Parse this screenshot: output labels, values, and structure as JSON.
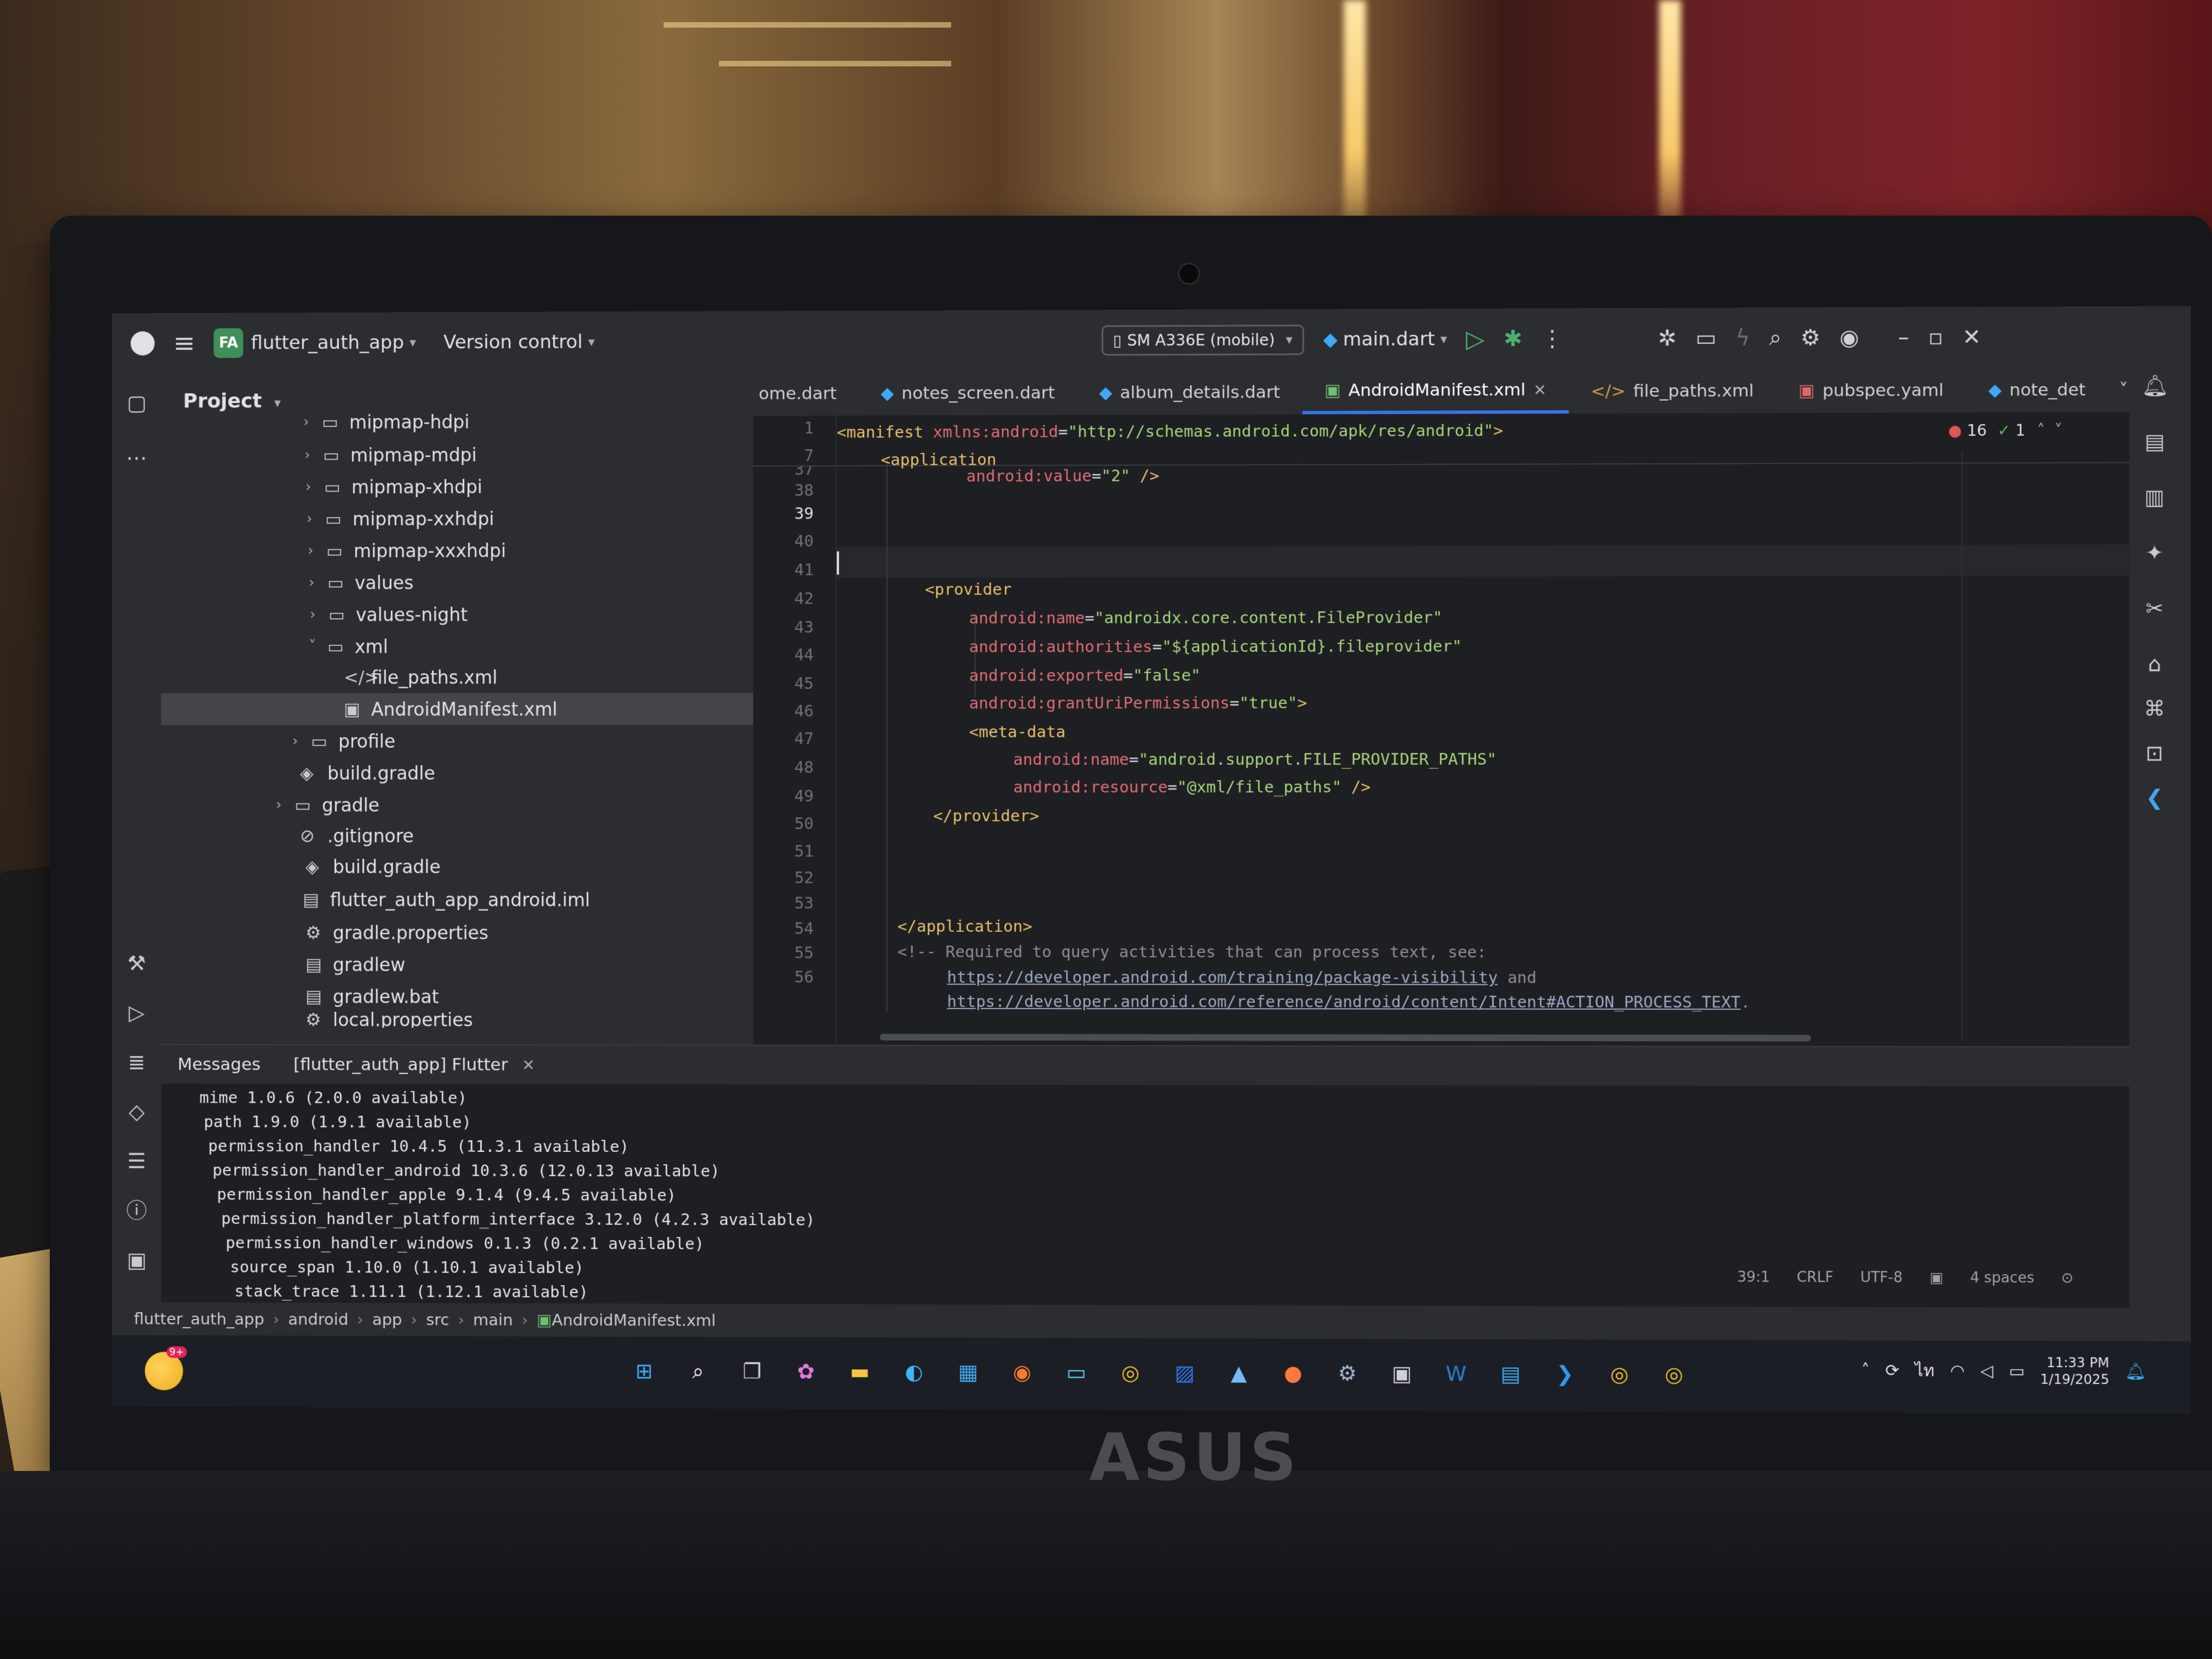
{
  "ide": {
    "project_badge": "FA",
    "project_name": "flutter_auth_app",
    "version_control": "Version control",
    "device": "SM A336E (mobile)",
    "run_config": "main.dart"
  },
  "project_panel": {
    "title": "Project",
    "tree": [
      {
        "label": "mipmap-hdpi",
        "type": "folder"
      },
      {
        "label": "mipmap-mdpi",
        "type": "folder"
      },
      {
        "label": "mipmap-xhdpi",
        "type": "folder"
      },
      {
        "label": "mipmap-xxhdpi",
        "type": "folder"
      },
      {
        "label": "mipmap-xxxhdpi",
        "type": "folder"
      },
      {
        "label": "values",
        "type": "folder"
      },
      {
        "label": "values-night",
        "type": "folder"
      },
      {
        "label": "xml",
        "type": "folder-open"
      },
      {
        "label": "file_paths.xml",
        "type": "xml"
      },
      {
        "label": "AndroidManifest.xml",
        "type": "manifest"
      },
      {
        "label": "profile",
        "type": "folder"
      },
      {
        "label": "build.gradle",
        "type": "gradle"
      },
      {
        "label": "gradle",
        "type": "folder"
      },
      {
        "label": ".gitignore",
        "type": "ignore"
      },
      {
        "label": "build.gradle",
        "type": "gradle"
      },
      {
        "label": "flutter_auth_app_android.iml",
        "type": "file"
      },
      {
        "label": "gradle.properties",
        "type": "settings"
      },
      {
        "label": "gradlew",
        "type": "file"
      },
      {
        "label": "gradlew.bat",
        "type": "file"
      },
      {
        "label": "local.properties",
        "type": "settings"
      }
    ]
  },
  "tabs": [
    {
      "label": "ome.dart",
      "icon": "none"
    },
    {
      "label": "notes_screen.dart",
      "icon": "dart"
    },
    {
      "label": "album_details.dart",
      "icon": "dart"
    },
    {
      "label": "AndroidManifest.xml",
      "icon": "manifest",
      "active": true
    },
    {
      "label": "file_paths.xml",
      "icon": "xml"
    },
    {
      "label": "pubspec.yaml",
      "icon": "yaml"
    },
    {
      "label": "note_det",
      "icon": "dart"
    }
  ],
  "inspections": {
    "errors": "16",
    "ok": "1"
  },
  "editor": {
    "line_numbers": [
      "1",
      "7",
      "37",
      "38",
      "39",
      "40",
      "41",
      "42",
      "43",
      "44",
      "45",
      "46",
      "47",
      "48",
      "49",
      "50",
      "51",
      "52",
      "53",
      "54",
      "55",
      "56"
    ],
    "current_line": "39",
    "sticky_1": {
      "tag": "<manifest ",
      "attr": "xmlns:android",
      "eq": "=",
      "val": "\"http://schemas.android.com/apk/res/android\"",
      "end": ">"
    },
    "sticky_2": {
      "tag": "<application"
    },
    "line_37": {
      "attr": "android:value",
      "eq": "=",
      "val": "\"2\"",
      "end": " />"
    },
    "line_40": {
      "tag": "<provider"
    },
    "line_41": {
      "attr": "android:name",
      "eq": "=",
      "val": "\"androidx.core.content.FileProvider\""
    },
    "line_42": {
      "attr": "android:authorities",
      "eq": "=",
      "val": "\"${applicationId}.fileprovider\""
    },
    "line_43": {
      "attr": "android:exported",
      "eq": "=",
      "val": "\"false\""
    },
    "line_44": {
      "attr": "android:grantUriPermissions",
      "eq": "=",
      "val": "\"true\"",
      "end": ">"
    },
    "line_45": {
      "tag": "<meta-data"
    },
    "line_46": {
      "attr": "android:name",
      "eq": "=",
      "val": "\"android.support.FILE_PROVIDER_PATHS\""
    },
    "line_47": {
      "attr": "android:resource",
      "eq": "=",
      "val": "\"@xml/file_paths\"",
      "end": " />"
    },
    "line_48": {
      "tag": "</provider>"
    },
    "line_52": {
      "tag": "</application>"
    },
    "line_53": {
      "comment": "<!-- Required to query activities that can process text, see:"
    },
    "line_54": {
      "link": "https://developer.android.com/training/package-visibility",
      "after": " and"
    },
    "line_55": {
      "link": "https://developer.android.com/reference/android/content/Intent#ACTION_PROCESS_TEXT",
      "after": "."
    }
  },
  "messages": {
    "tab_1": "Messages",
    "tab_2": "[flutter_auth_app] Flutter",
    "lines": [
      "mime 1.0.6 (2.0.0 available)",
      "path 1.9.0 (1.9.1 available)",
      "permission_handler 10.4.5 (11.3.1 available)",
      "permission_handler_android 10.3.6 (12.0.13 available)",
      "permission_handler_apple 9.1.4 (9.4.5 available)",
      "permission_handler_platform_interface 3.12.0 (4.2.3 available)",
      "permission_handler_windows 0.1.3 (0.2.1 available)",
      "source_span 1.10.0 (1.10.1 available)",
      "stack_trace 1.11.1 (1.12.1 available)"
    ]
  },
  "status": {
    "position": "39:1",
    "line_ending": "CRLF",
    "encoding": "UTF-8",
    "indent": "4 spaces"
  },
  "breadcrumb": [
    "flutter_auth_app",
    "android",
    "app",
    "src",
    "main",
    "AndroidManifest.xml"
  ],
  "taskbar": {
    "weather_badge": "9+",
    "time": "11:33 PM",
    "date": "1/19/2025"
  },
  "laptop_brand": "ASUS"
}
